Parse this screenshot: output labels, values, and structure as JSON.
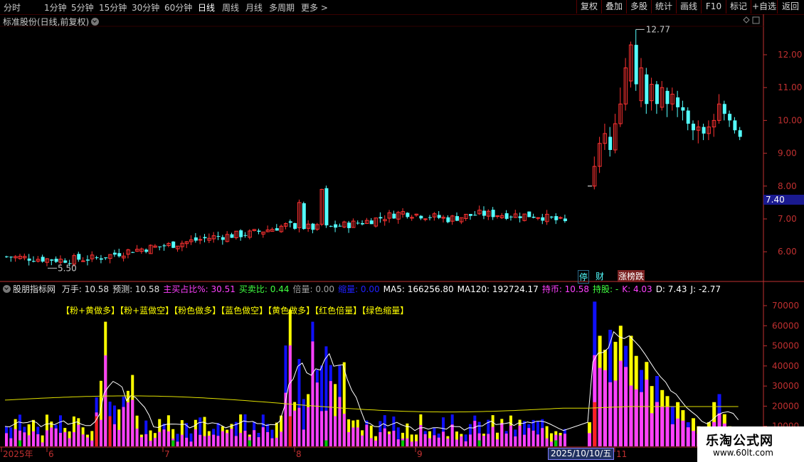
{
  "toolbar": {
    "periods": [
      "分时",
      "1分钟",
      "5分钟",
      "15分钟",
      "30分钟",
      "60分钟",
      "日线",
      "周线",
      "月线",
      "多周期",
      "更多 >"
    ],
    "active_period": "日线",
    "right_buttons": [
      "复权",
      "叠加",
      "多股",
      "统计",
      "画线",
      "F10",
      "标记",
      "+自选",
      "返回"
    ]
  },
  "chart_title": "标准股份(日线,前复权)",
  "price_axis": [
    "12.00",
    "11.00",
    "10.00",
    "9.00",
    "8.00",
    "7.00",
    "6.00"
  ],
  "current_price_tag": "7.40",
  "high_label": "12.77",
  "low_label": "5.50",
  "event_tags": [
    "停",
    "财",
    "涨榜跌"
  ],
  "indicator": {
    "name": "股朋指标网",
    "items": [
      {
        "label": "万手: 10.58",
        "color": "#e0e0e0"
      },
      {
        "label": "预测: 10.58",
        "color": "#e0e0e0"
      },
      {
        "label": "主买占比%: 30.51",
        "color": "#ff40ff"
      },
      {
        "label": "买卖比: 0.44",
        "color": "#40ff40"
      },
      {
        "label": "倍量: 0.00",
        "color": "#a0a0a0"
      },
      {
        "label": "缩量: 0.00",
        "color": "#2020ff"
      },
      {
        "label": "MA5: 166256.80",
        "color": "#ffffff"
      },
      {
        "label": "MA120: 192724.17",
        "color": "#ffffff"
      },
      {
        "label": "持币: 10.58",
        "color": "#ff40ff"
      },
      {
        "label": "持股: -",
        "color": "#40ff40"
      },
      {
        "label": "K: 4.03",
        "color": "#ff40ff"
      },
      {
        "label": "D: 7.43",
        "color": "#ffffff"
      },
      {
        "label": "J: -2.77",
        "color": "#ffffff"
      }
    ],
    "legend": [
      "【粉+黄做多】",
      "【粉+蓝做空】",
      "【粉色做多】",
      "【蓝色做空】",
      "【黄色做多】",
      "【红色倍量】",
      "【绿色缩量】"
    ]
  },
  "volume_axis": [
    "70000",
    "60000",
    "50000",
    "40000",
    "30000",
    "20000",
    "10000"
  ],
  "date_axis": [
    "2025年",
    "6",
    "7",
    "8",
    "9",
    "10",
    "11"
  ],
  "selected_date": "2025/10/10/五",
  "watermark": {
    "title": "乐淘公式网",
    "url": "www.60lt.com"
  },
  "colors": {
    "up": "#ff3232",
    "down": "#54ffff",
    "pink": "#ff40ff",
    "blue": "#1010ff",
    "yellow": "#ffff00",
    "axis": "#c03030",
    "bg": "#000000"
  }
}
